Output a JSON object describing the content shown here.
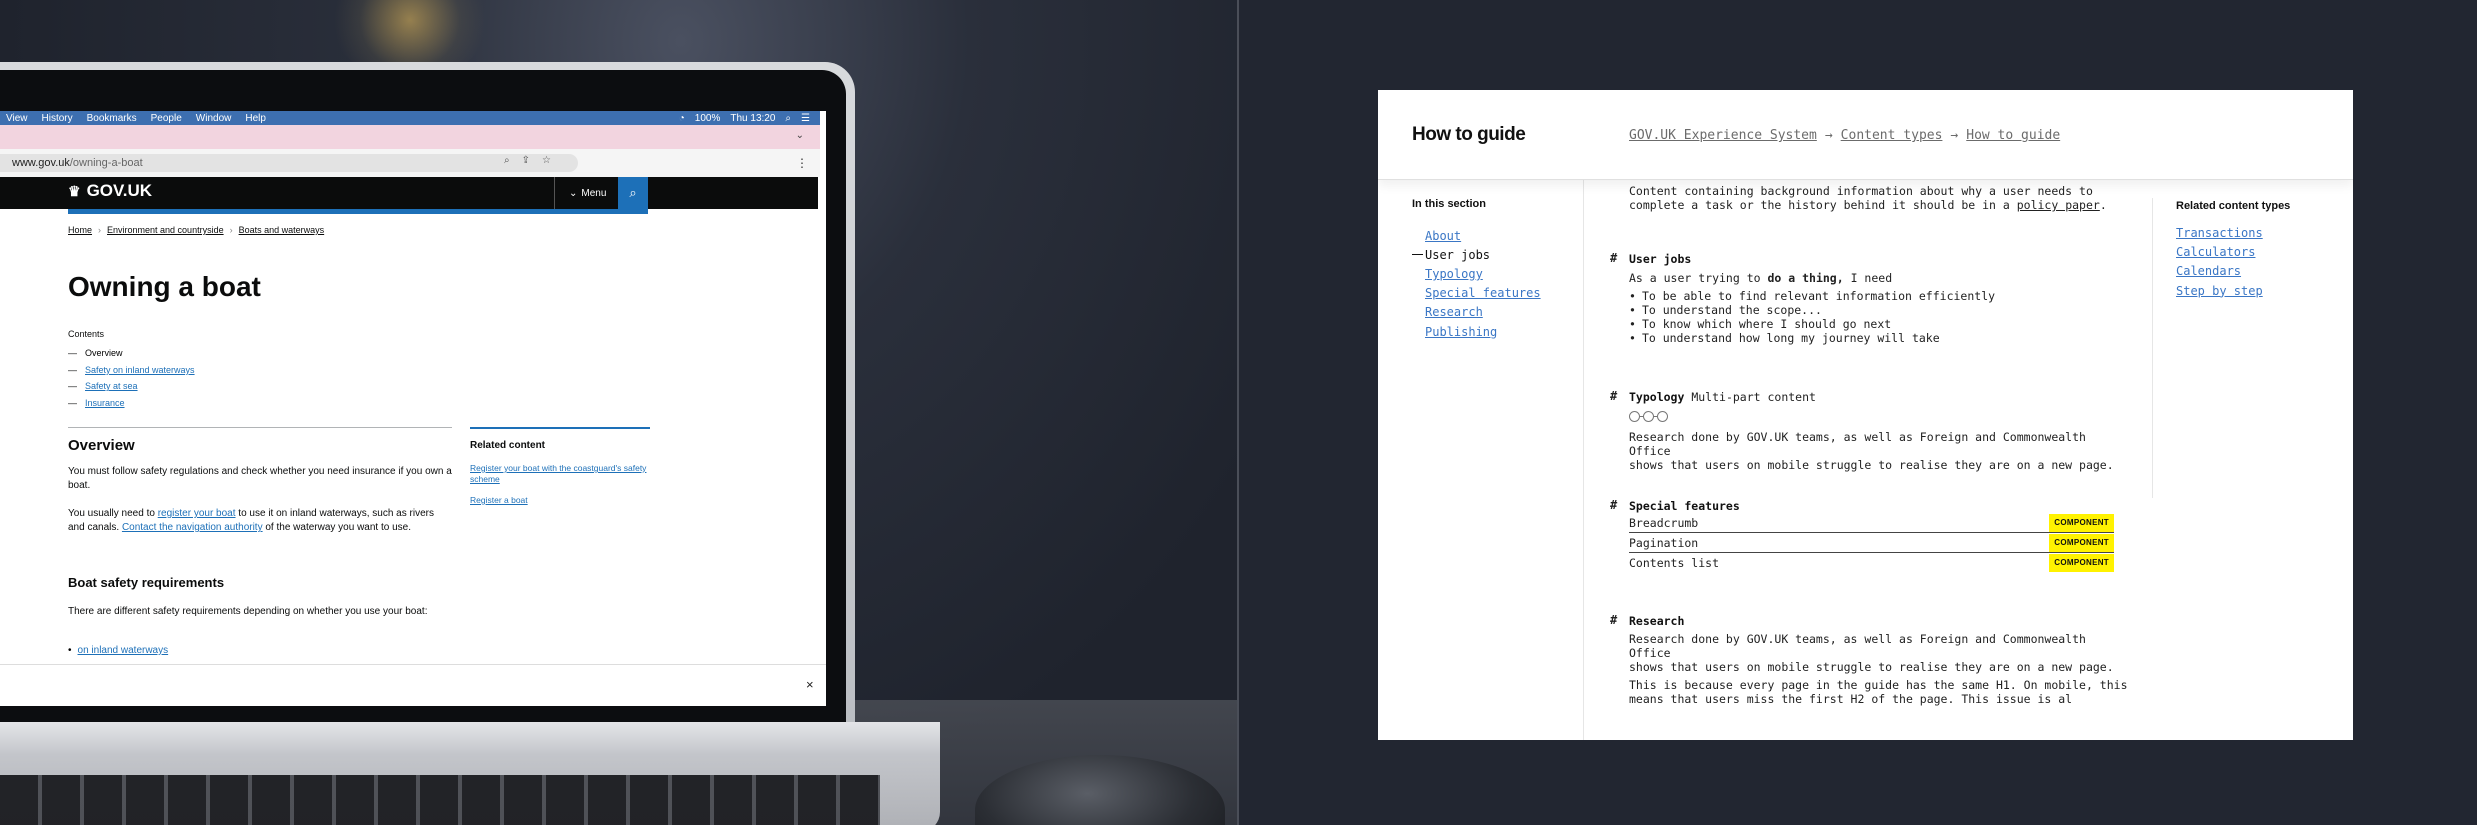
{
  "left_screen": {
    "menubar": {
      "items": [
        "View",
        "History",
        "Bookmarks",
        "People",
        "Window",
        "Help"
      ],
      "battery": "100%",
      "time": "Thu 13:20"
    },
    "url": {
      "domain": "www.gov.uk",
      "path": "/owning-a-boat"
    },
    "gov_header": {
      "logo": "GOV.UK",
      "menu": "Menu"
    },
    "breadcrumbs": [
      "Home",
      "Environment and countryside",
      "Boats and waterways"
    ],
    "title": "Owning a boat",
    "contents": {
      "label": "Contents",
      "items": [
        {
          "label": "Overview",
          "link": false
        },
        {
          "label": "Safety on inland waterways",
          "link": true
        },
        {
          "label": "Safety at sea",
          "link": true
        },
        {
          "label": "Insurance",
          "link": true
        }
      ]
    },
    "overview": {
      "heading": "Overview",
      "p1": "You must follow safety regulations and check whether you need insurance if you own a boat.",
      "p2_pre": "You usually need to ",
      "p2_link1": "register your boat",
      "p2_mid": " to use it on inland waterways, such as rivers and canals. ",
      "p2_link2": "Contact the navigation authority",
      "p2_post": " of the waterway you want to use."
    },
    "related": {
      "heading": "Related content",
      "links": [
        "Register your boat with the coastguard's safety scheme",
        "Register a boat"
      ]
    },
    "boat_safety": {
      "heading": "Boat safety requirements",
      "p": "There are different safety requirements depending on whether you use your boat:",
      "bullet": "on inland waterways"
    },
    "close_glyph": "×"
  },
  "doc": {
    "title": "How to guide",
    "breadcrumbs": [
      "GOV.UK Experience System",
      "Content types",
      "How to guide"
    ],
    "breadcrumb_sep": "→",
    "section_nav": {
      "title": "In this section",
      "items": [
        {
          "label": "About",
          "active": false
        },
        {
          "label": "User jobs",
          "active": true
        },
        {
          "label": "Typology",
          "active": false
        },
        {
          "label": "Special features",
          "active": false
        },
        {
          "label": "Research",
          "active": false
        },
        {
          "label": "Publishing",
          "active": false
        }
      ]
    },
    "related": {
      "title": "Related content types",
      "items": [
        "Transactions",
        "Calculators",
        "Calendars",
        "Step by step"
      ]
    },
    "intro": {
      "line1": "Content containing background information about why a user needs to",
      "line2_pre": "complete a task or the history behind it should be in a ",
      "line2_link": "policy paper",
      "line2_post": "."
    },
    "user_jobs": {
      "heading": "User jobs",
      "lead_pre": "As a user trying to ",
      "lead_bold": "do a thing,",
      "lead_post": " I need",
      "items": [
        "To be able to find relevant information efficiently",
        "To understand the scope...",
        "To know which where I should go next",
        "To understand how long my journey will take"
      ]
    },
    "typology": {
      "heading": "Typology",
      "value": "Multi-part content",
      "text1": "Research done by GOV.UK teams, as well as Foreign and Commonwealth Office",
      "text2": "shows that users on mobile struggle to realise they are on a new page."
    },
    "special_features": {
      "heading": "Special features",
      "rows": [
        {
          "label": "Breadcrumb",
          "badge": "COMPONENT"
        },
        {
          "label": "Pagination",
          "badge": "COMPONENT"
        },
        {
          "label": "Contents list",
          "badge": "COMPONENT"
        }
      ]
    },
    "research": {
      "heading": "Research",
      "p1a": "Research done by GOV.UK teams, as well as Foreign and Commonwealth Office",
      "p1b": "shows that users on mobile struggle to realise they are on a new page.",
      "p2a": "This is because every page in the guide has the same H1. On mobile, this",
      "p2b": "means that users miss the first H2 of the page. This issue is al"
    },
    "hash_glyph": "#",
    "badge_color": "#fff200",
    "link_color": "#3a76c5"
  }
}
